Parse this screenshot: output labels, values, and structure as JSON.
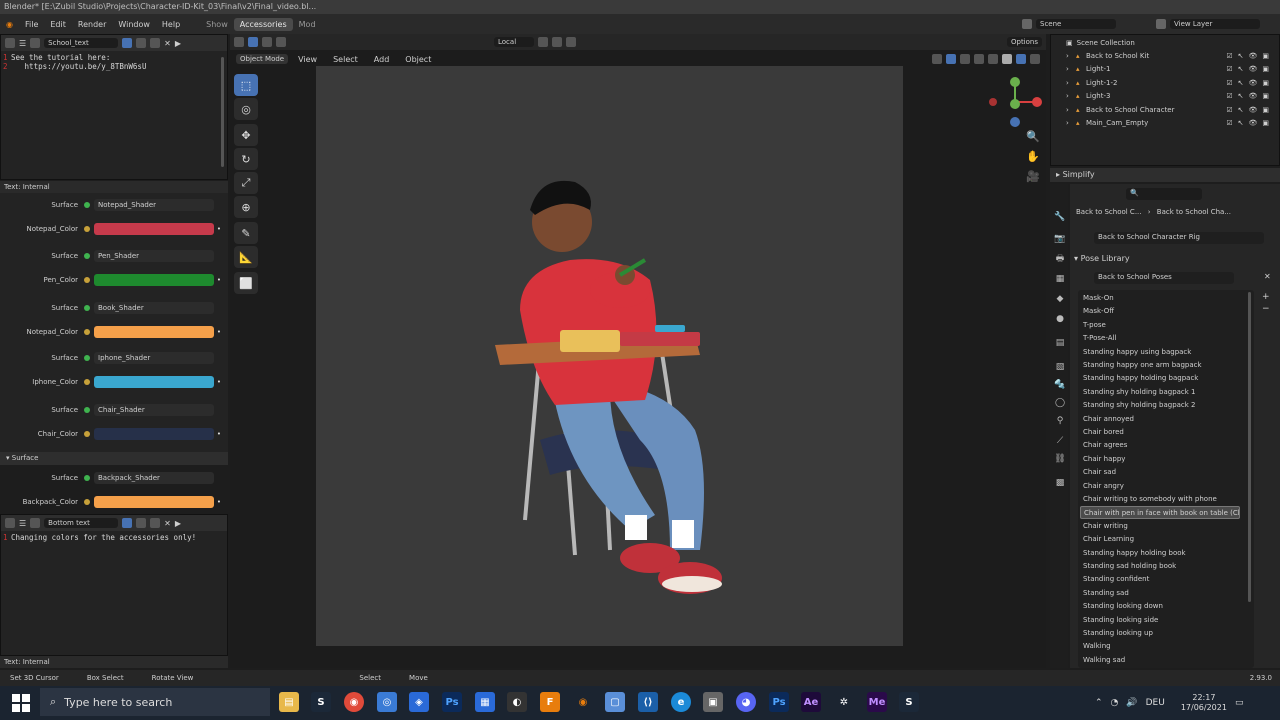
{
  "window": {
    "title": "Blender* [E:\\Zubil Studio\\Projects\\Character-ID-Kit_03\\Final\\v2\\Final_video.bl..."
  },
  "menu": {
    "items": [
      "File",
      "Edit",
      "Render",
      "Window",
      "Help"
    ]
  },
  "workspaces": {
    "tabs": [
      "Show",
      "Accessories",
      "Mod"
    ],
    "active": "Accessories"
  },
  "scene": {
    "label": "Scene",
    "view_layer": "View Layer"
  },
  "text_editor_top": {
    "name": "School_text",
    "lines": [
      "See the tutorial here:",
      "   https://youtu.be/y_8TBnW6sU"
    ],
    "line_numbers": [
      "1",
      "2"
    ],
    "footer": "Text: Internal"
  },
  "shader_props": [
    {
      "label": "Surface",
      "value": "Notepad_Shader",
      "kind": "surface"
    },
    {
      "label": "Notepad_Color",
      "value": "",
      "color": "#c63a4b",
      "kind": "color"
    },
    {
      "label": "Surface",
      "value": "Pen_Shader",
      "kind": "surface"
    },
    {
      "label": "Pen_Color",
      "value": "",
      "color": "#1e8a2e",
      "kind": "color"
    },
    {
      "label": "Surface",
      "value": "Book_Shader",
      "kind": "surface"
    },
    {
      "label": "Notepad_Color",
      "value": "",
      "color": "#f5a04a",
      "kind": "color"
    },
    {
      "label": "Surface",
      "value": "Iphone_Shader",
      "kind": "surface"
    },
    {
      "label": "Iphone_Color",
      "value": "",
      "color": "#3aa7cf",
      "kind": "color"
    },
    {
      "label": "Surface",
      "value": "Chair_Shader",
      "kind": "surface"
    },
    {
      "label": "Chair_Color",
      "value": "",
      "color": "#263049",
      "kind": "color"
    }
  ],
  "surface_panel": {
    "title": "Surface",
    "rows": [
      {
        "label": "Surface",
        "value": "Backpack_Shader",
        "kind": "surface"
      },
      {
        "label": "Backpack_Color",
        "value": "",
        "color": "#f5a04a",
        "kind": "color"
      }
    ]
  },
  "text_editor_bottom": {
    "name": "Bottom text",
    "lines": [
      "Changing colors for the accessories only!"
    ],
    "line_numbers": [
      "1"
    ],
    "footer": "Text: Internal"
  },
  "viewport": {
    "mode": "Object Mode",
    "menus": [
      "View",
      "Select",
      "Add",
      "Object"
    ],
    "transform": "Local",
    "options": "Options"
  },
  "outliner": {
    "title": "Scene Collection",
    "items": [
      "Back to School Kit",
      "Light-1",
      "Light-1-2",
      "Light-3",
      "Back to School Character",
      "Main_Cam_Empty"
    ]
  },
  "properties": {
    "simplify": "Simplify",
    "breadcrumb": [
      "Back to School C...",
      "Back to School Cha..."
    ],
    "rig": "Back to School Character Rig",
    "pose_library_title": "Pose Library",
    "pose_library_name": "Back to School Poses",
    "poses": [
      "Mask-On",
      "Mask-Off",
      "T-pose",
      "T-Pose-All",
      "Standing happy using bagpack",
      "Standing happy one arm bagpack",
      "Standing happy holding bagpack",
      "Standing shy holding bagpack 1",
      "Standing shy holding bagpack 2",
      "Chair annoyed",
      "Chair bored",
      "Chair agrees",
      "Chair happy",
      "Chair sad",
      "Chair angry",
      "Chair writing to somebody with phone",
      "Chair with pen in face with book on table (Ch...",
      "Chair writing",
      "Chair Learning",
      "Standing happy holding book",
      "Standing sad holding book",
      "Standing confident",
      "Standing sad",
      "Standing looking down",
      "Standing looking side",
      "Standing looking up",
      "Walking",
      "Walking sad"
    ],
    "selected_pose_index": 16
  },
  "statusbar": {
    "left": [
      "Set 3D Cursor",
      "Box Select",
      "Rotate View"
    ],
    "mid": [
      "Select",
      "Move"
    ],
    "version": "2.93.0"
  },
  "taskbar": {
    "search_placeholder": "Type here to search",
    "time": "22:17",
    "date": "17/06/2021",
    "lang": "DEU"
  }
}
